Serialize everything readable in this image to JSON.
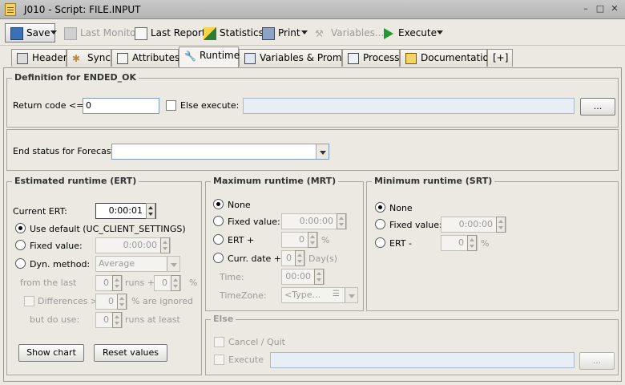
{
  "window": {
    "title": "J010 - Script: FILE.INPUT"
  },
  "toolbar": {
    "save": "Save",
    "last_monitor": "Last Monitor",
    "last_report": "Last Report",
    "statistics": "Statistics",
    "print": "Print",
    "variables": "Variables...",
    "execute": "Execute"
  },
  "tabs": [
    {
      "label": "Header"
    },
    {
      "label": "Sync"
    },
    {
      "label": "Attributes"
    },
    {
      "label": "Runtime"
    },
    {
      "label": "Variables & Prompts"
    },
    {
      "label": "Process"
    },
    {
      "label": "Documentation"
    },
    {
      "label": "[+]"
    }
  ],
  "definition": {
    "title": "Definition for ENDED_OK",
    "return_code_label": "Return code <=:",
    "return_code_value": "0",
    "else_execute_label": "Else execute:",
    "browse": "..."
  },
  "forecast": {
    "label": "End status for Forecast:",
    "value": ""
  },
  "ert": {
    "title": "Estimated runtime (ERT)",
    "current_label": "Current ERT:",
    "current_value": "0:00:01",
    "use_default": "Use default (UC_CLIENT_SETTINGS)",
    "fixed_value_label": "Fixed value:",
    "fixed_value": "0:00:00",
    "dyn_method_label": "Dyn. method:",
    "dyn_method_value": "Average",
    "from_the_last": "from the last",
    "runs_plus": "runs +",
    "runs_value": "0",
    "percent_value": "0",
    "percent": "%",
    "differences": "Differences >",
    "differences_value": "0",
    "are_ignored": "% are ignored",
    "but_do_use": "but do use:",
    "but_do_use_value": "0",
    "runs_at_least": "runs at least",
    "show_chart": "Show chart",
    "reset_values": "Reset values"
  },
  "mrt": {
    "title": "Maximum runtime (MRT)",
    "none": "None",
    "fixed_value_label": "Fixed value:",
    "fixed_value": "0:00:00",
    "ert_plus": "ERT +",
    "ert_plus_value": "0",
    "percent": "%",
    "curr_date_plus": "Curr. date +",
    "curr_date_value": "0",
    "days": "Day(s)",
    "time_label": "Time:",
    "time_value": "00:00",
    "timezone_label": "TimeZone:",
    "timezone_value": "<Type..."
  },
  "srt": {
    "title": "Minimum runtime (SRT)",
    "none": "None",
    "fixed_value_label": "Fixed value:",
    "fixed_value": "0:00:00",
    "ert_minus": "ERT -",
    "ert_minus_value": "0",
    "percent": "%"
  },
  "else_group": {
    "title": "Else",
    "cancel_quit": "Cancel / Quit",
    "execute": "Execute",
    "browse": "..."
  }
}
